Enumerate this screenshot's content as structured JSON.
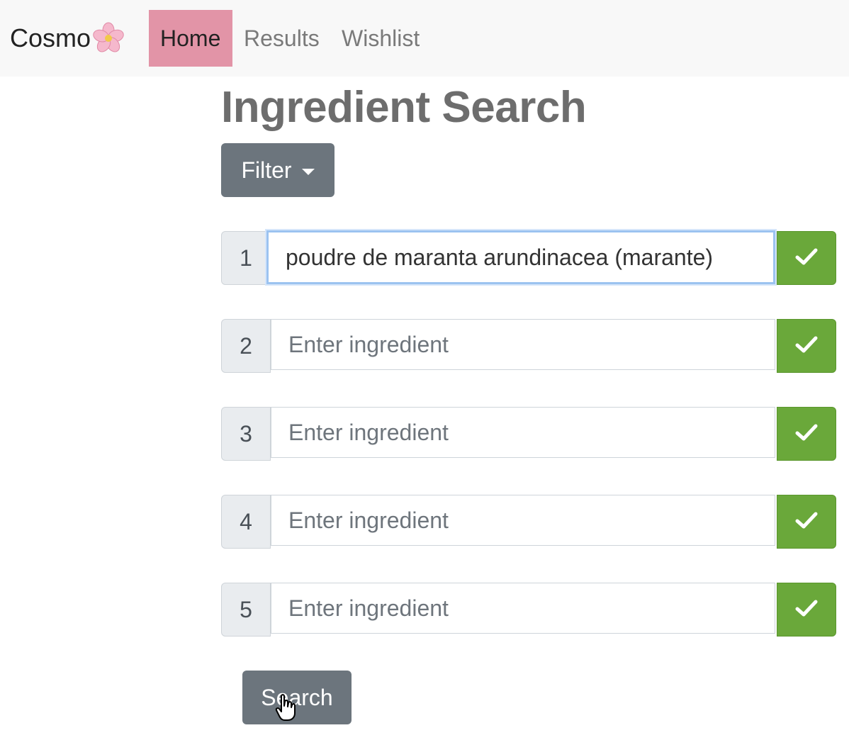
{
  "brand": {
    "name": "Cosmo",
    "logo_icon": "cherry-blossom-icon"
  },
  "nav": {
    "items": [
      {
        "label": "Home",
        "active": true
      },
      {
        "label": "Results",
        "active": false
      },
      {
        "label": "Wishlist",
        "active": false
      }
    ]
  },
  "page": {
    "title": "Ingredient Search"
  },
  "filter": {
    "label": "Filter"
  },
  "ingredients": [
    {
      "index": "1",
      "value": "poudre de maranta arundinacea (marante)",
      "placeholder": "Enter ingredient"
    },
    {
      "index": "2",
      "value": "",
      "placeholder": "Enter ingredient"
    },
    {
      "index": "3",
      "value": "",
      "placeholder": "Enter ingredient"
    },
    {
      "index": "4",
      "value": "",
      "placeholder": "Enter ingredient"
    },
    {
      "index": "5",
      "value": "",
      "placeholder": "Enter ingredient"
    }
  ],
  "search": {
    "label": "Search"
  },
  "colors": {
    "nav_active": "#e294a7",
    "button_grey": "#6c757d",
    "confirm_green": "#6aa83a",
    "title_grey": "#6d6d6d"
  }
}
